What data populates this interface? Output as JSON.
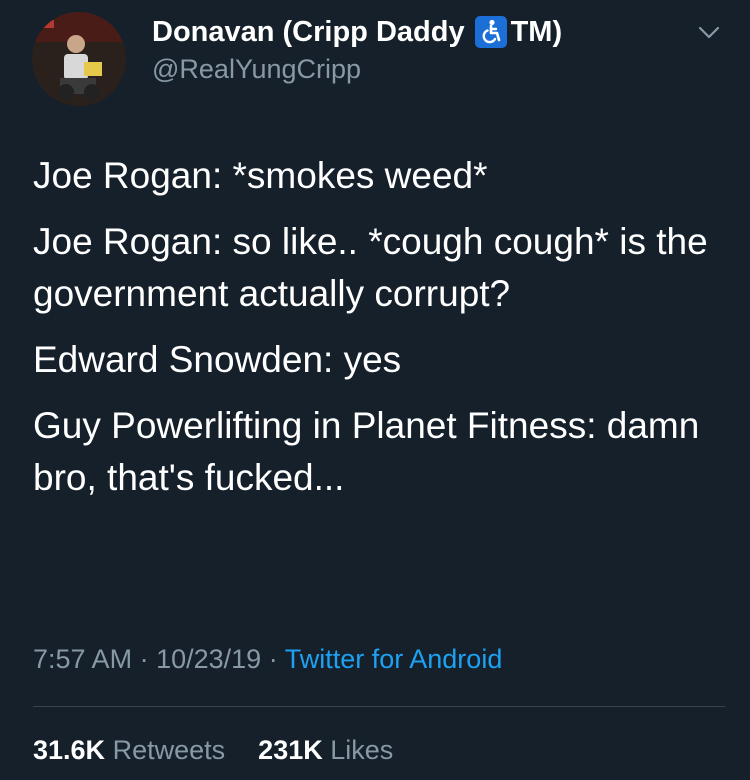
{
  "author": {
    "name_prefix": "Donavan (Cripp Daddy",
    "name_suffix": "TM)",
    "handle": "@RealYungCripp",
    "icon": "accessibility-icon"
  },
  "tweet": {
    "lines": [
      "Joe Rogan: *smokes weed*",
      "Joe Rogan: so like.. *cough cough* is the government actually corrupt?",
      "Edward Snowden: yes",
      "Guy Powerlifting in Planet Fitness: damn bro, that's fucked..."
    ]
  },
  "meta": {
    "time": "7:57 AM",
    "sep1": "·",
    "date": "10/23/19",
    "sep2": "·",
    "source": "Twitter for Android"
  },
  "stats": {
    "retweets_count": "31.6K",
    "retweets_label": "Retweets",
    "likes_count": "231K",
    "likes_label": "Likes"
  },
  "colors": {
    "background": "#15202b",
    "secondary_text": "#8899a6",
    "link": "#1da1f2",
    "divider": "#38444d"
  }
}
